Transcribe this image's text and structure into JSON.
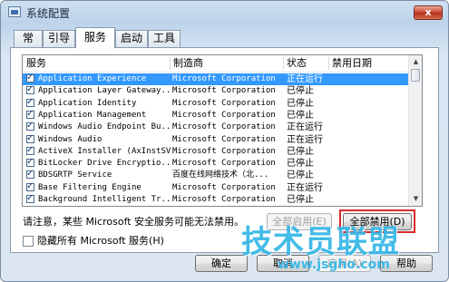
{
  "window": {
    "title": "系统配置",
    "close_label": "x"
  },
  "tabs": [
    {
      "label": "常规",
      "active": false
    },
    {
      "label": "引导",
      "active": false
    },
    {
      "label": "服务",
      "active": true
    },
    {
      "label": "启动",
      "active": false
    },
    {
      "label": "工具",
      "active": false
    }
  ],
  "table": {
    "headers": {
      "service": "服务",
      "manufacturer": "制造商",
      "status": "状态",
      "disabled_date": "禁用日期"
    },
    "rows": [
      {
        "name": "Application Experience",
        "manufacturer": "Microsoft Corporation",
        "status": "正在运行",
        "date": "",
        "checked": true,
        "selected": true
      },
      {
        "name": "Application Layer Gateway...",
        "manufacturer": "Microsoft Corporation",
        "status": "已停止",
        "date": "",
        "checked": true,
        "selected": false
      },
      {
        "name": "Application Identity",
        "manufacturer": "Microsoft Corporation",
        "status": "已停止",
        "date": "",
        "checked": true,
        "selected": false
      },
      {
        "name": "Application Management",
        "manufacturer": "Microsoft Corporation",
        "status": "已停止",
        "date": "",
        "checked": true,
        "selected": false
      },
      {
        "name": "Windows Audio Endpoint Bu...",
        "manufacturer": "Microsoft Corporation",
        "status": "正在运行",
        "date": "",
        "checked": true,
        "selected": false
      },
      {
        "name": "Windows Audio",
        "manufacturer": "Microsoft Corporation",
        "status": "正在运行",
        "date": "",
        "checked": true,
        "selected": false
      },
      {
        "name": "ActiveX Installer (AxInstSV)",
        "manufacturer": "Microsoft Corporation",
        "status": "已停止",
        "date": "",
        "checked": true,
        "selected": false
      },
      {
        "name": "BitLocker Drive Encryptio...",
        "manufacturer": "Microsoft Corporation",
        "status": "已停止",
        "date": "",
        "checked": true,
        "selected": false
      },
      {
        "name": "BDSGRTP Service",
        "manufacturer": "百度在线网络技术（北...",
        "status": "已停止",
        "date": "",
        "checked": true,
        "selected": false
      },
      {
        "name": "Base Filtering Engine",
        "manufacturer": "Microsoft Corporation",
        "status": "正在运行",
        "date": "",
        "checked": true,
        "selected": false
      },
      {
        "name": "Background Intelligent Tr...",
        "manufacturer": "Microsoft Corporation",
        "status": "已停止",
        "date": "",
        "checked": true,
        "selected": false
      }
    ]
  },
  "note": "请注意，某些 Microsoft 安全服务可能无法禁用。",
  "buttons": {
    "enable_all": "全部启用(E)",
    "disable_all": "全部禁用(D)",
    "ok": "确定",
    "cancel": "取消",
    "apply": "应用(A)",
    "help": "帮助"
  },
  "hide_ms_label": "隐藏所有 Microsoft 服务(H)",
  "watermark": {
    "text": "技术员联盟",
    "url": "www.jsgho.com"
  },
  "colors": {
    "selection": "#3399ff",
    "highlight_border": "#d62a2a",
    "watermark": "#35b7e6"
  }
}
